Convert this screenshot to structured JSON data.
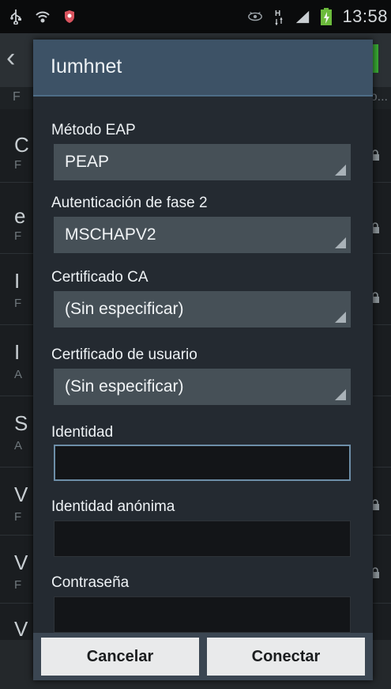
{
  "status_bar": {
    "time": "13:58",
    "icons": [
      "usb-icon",
      "wifi-settings-icon",
      "shield-icon",
      "eye-icon",
      "hspa-icon",
      "signal-icon",
      "battery-icon"
    ]
  },
  "background": {
    "rows": [
      {
        "letter": "C",
        "sub": "F"
      },
      {
        "letter": "e",
        "sub": "F"
      },
      {
        "letter": "I",
        "sub": "F"
      },
      {
        "letter": "I",
        "sub": "A"
      },
      {
        "letter": "S",
        "sub": "A"
      },
      {
        "letter": "V",
        "sub": "F"
      },
      {
        "letter": "V",
        "sub": "F"
      },
      {
        "letter": "V",
        "sub": ""
      }
    ],
    "header_left": "F",
    "header_right": "o..."
  },
  "dialog": {
    "title": "Iumhnet",
    "eap_method": {
      "label": "Método EAP",
      "value": "PEAP"
    },
    "phase2_auth": {
      "label": "Autenticación de fase 2",
      "value": "MSCHAPV2"
    },
    "ca_certificate": {
      "label": "Certificado CA",
      "value": "(Sin especificar)"
    },
    "user_certificate": {
      "label": "Certificado de usuario",
      "value": "(Sin especificar)"
    },
    "identity": {
      "label": "Identidad",
      "value": ""
    },
    "anonymous_identity": {
      "label": "Identidad anónima",
      "value": ""
    },
    "password": {
      "label": "Contraseña",
      "value": ""
    },
    "buttons": {
      "cancel": "Cancelar",
      "connect": "Conectar"
    }
  },
  "colors": {
    "title_bar": "#3d5266",
    "select_bg": "#465057",
    "focus_border": "#6d8ea8",
    "accent_green": "#3aaa35"
  }
}
